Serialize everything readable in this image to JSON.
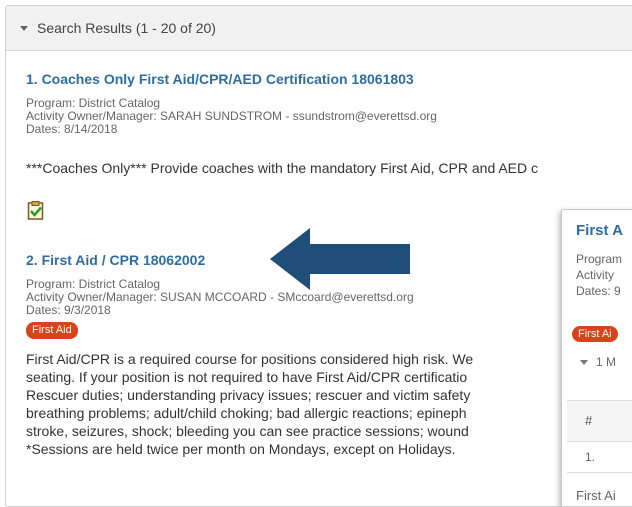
{
  "header": {
    "title": "Search Results (1 - 20 of 20)"
  },
  "results": [
    {
      "title": "1. Coaches Only First Aid/CPR/AED Certification 18061803",
      "program": "Program: District Catalog",
      "owner": "Activity Owner/Manager: SARAH SUNDSTROM  - ssundstrom@everettsd.org",
      "dates": "Dates: 8/14/2018",
      "description": "***Coaches Only*** Provide coaches with the mandatory First Aid, CPR and AED c"
    },
    {
      "title": "2. First Aid / CPR 18062002",
      "program": "Program: District Catalog",
      "owner": "Activity Owner/Manager: SUSAN MCCOARD  - SMccoard@everettsd.org",
      "dates": "Dates: 9/3/2018",
      "badge": "First Aid",
      "description_lines": [
        "First Aid/CPR is a required course for positions considered high risk. We",
        "seating. If your position is not required to have First Aid/CPR certificatio",
        "Rescuer duties; understanding privacy issues; rescuer and victim safety",
        "breathing problems; adult/child choking; bad allergic reactions; epineph",
        "stroke, seizures, shock; bleeding you can see practice sessions; wound",
        "*Sessions are held twice per month on Mondays, except on Holidays."
      ]
    }
  ],
  "side_panel": {
    "title": "First A",
    "program": "Program",
    "activity": "Activity",
    "dates": "Dates: 9",
    "badge": "First Ai",
    "sessions": "1 M",
    "table_header": "#",
    "table_row": "1.",
    "next_line": "First Ai"
  },
  "colors": {
    "link": "#2e6da4",
    "badge": "#d9421a",
    "arrow": "#1f4e79"
  },
  "icons": {
    "clipboard": "clipboard-check-icon",
    "arrow": "left-arrow-icon"
  }
}
